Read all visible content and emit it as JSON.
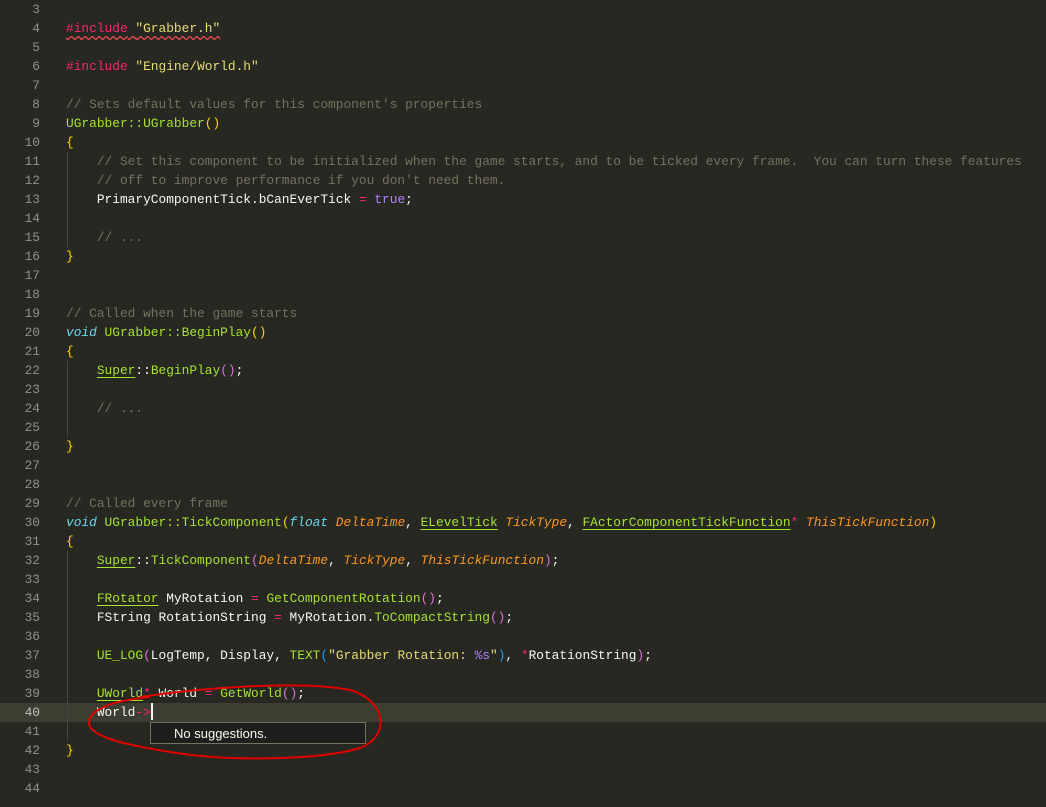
{
  "editor": {
    "current_line": 40,
    "lines": [
      {
        "n": "3",
        "t": []
      },
      {
        "n": "4",
        "t": [
          [
            "kw squig",
            "#include"
          ],
          [
            "squig",
            " "
          ],
          [
            "str squig",
            "\"Grabber.h\""
          ]
        ]
      },
      {
        "n": "5",
        "t": []
      },
      {
        "n": "6",
        "t": [
          [
            "kw",
            "#include"
          ],
          [
            "",
            ""
          ],
          [
            "str",
            " \"Engine/World.h\""
          ]
        ]
      },
      {
        "n": "7",
        "t": []
      },
      {
        "n": "8",
        "t": [
          [
            "cm",
            "// Sets default values for this component's properties"
          ]
        ]
      },
      {
        "n": "9",
        "t": [
          [
            "fn",
            "UGrabber::UGrabber"
          ],
          [
            "b1",
            "()"
          ]
        ]
      },
      {
        "n": "10",
        "t": [
          [
            "b1",
            "{"
          ]
        ]
      },
      {
        "n": "11",
        "t": [
          [
            "cm",
            "    // Set this component to be initialized when the game starts, and to be ticked every frame.  You can turn these features"
          ]
        ]
      },
      {
        "n": "12",
        "t": [
          [
            "cm",
            "    // off to improve performance if you don't need them."
          ]
        ]
      },
      {
        "n": "13",
        "t": [
          [
            "",
            "    PrimaryComponentTick.bCanEverTick "
          ],
          [
            "op",
            "="
          ],
          [
            "num",
            " true"
          ],
          [
            "",
            ";"
          ]
        ]
      },
      {
        "n": "14",
        "t": []
      },
      {
        "n": "15",
        "t": [
          [
            "cm",
            "    // ..."
          ]
        ]
      },
      {
        "n": "16",
        "t": [
          [
            "b1",
            "}"
          ]
        ]
      },
      {
        "n": "17",
        "t": []
      },
      {
        "n": "18",
        "t": []
      },
      {
        "n": "19",
        "t": [
          [
            "cm",
            "// Called when the game starts"
          ]
        ]
      },
      {
        "n": "20",
        "t": [
          [
            "ty",
            "void"
          ],
          [
            "fn",
            " UGrabber::BeginPlay"
          ],
          [
            "b1",
            "()"
          ]
        ]
      },
      {
        "n": "21",
        "t": [
          [
            "b1",
            "{"
          ]
        ]
      },
      {
        "n": "22",
        "t": [
          [
            "",
            "    "
          ],
          [
            "fn ul",
            "Super"
          ],
          [
            "",
            "::"
          ],
          [
            "fn",
            "BeginPlay"
          ],
          [
            "b2",
            "()"
          ],
          [
            "",
            ";"
          ]
        ]
      },
      {
        "n": "23",
        "t": []
      },
      {
        "n": "24",
        "t": [
          [
            "cm",
            "    // ..."
          ]
        ]
      },
      {
        "n": "25",
        "t": []
      },
      {
        "n": "26",
        "t": [
          [
            "b1",
            "}"
          ]
        ]
      },
      {
        "n": "27",
        "t": []
      },
      {
        "n": "28",
        "t": []
      },
      {
        "n": "29",
        "t": [
          [
            "cm",
            "// Called every frame"
          ]
        ]
      },
      {
        "n": "30",
        "t": [
          [
            "ty",
            "void"
          ],
          [
            "fn",
            " UGrabber::TickComponent"
          ],
          [
            "b1",
            "("
          ],
          [
            "ty",
            "float"
          ],
          [
            "pa",
            " DeltaTime"
          ],
          [
            "",
            ", "
          ],
          [
            "fn ul",
            "ELevelTick"
          ],
          [
            "pa",
            " TickType"
          ],
          [
            "",
            ", "
          ],
          [
            "fn ul",
            "FActorComponentTickFunction"
          ],
          [
            "kw",
            "*"
          ],
          [
            "pa",
            " ThisTickFunction"
          ],
          [
            "b1",
            ")"
          ]
        ]
      },
      {
        "n": "31",
        "t": [
          [
            "b1",
            "{"
          ]
        ]
      },
      {
        "n": "32",
        "t": [
          [
            "",
            "    "
          ],
          [
            "fn ul",
            "Super"
          ],
          [
            "",
            "::"
          ],
          [
            "fn",
            "TickComponent"
          ],
          [
            "b2",
            "("
          ],
          [
            "pa",
            "DeltaTime"
          ],
          [
            "",
            ", "
          ],
          [
            "pa",
            "TickType"
          ],
          [
            "",
            ", "
          ],
          [
            "pa",
            "ThisTickFunction"
          ],
          [
            "b2",
            ")"
          ],
          [
            "",
            ";"
          ]
        ]
      },
      {
        "n": "33",
        "t": []
      },
      {
        "n": "34",
        "t": [
          [
            "",
            "    "
          ],
          [
            "fn ul",
            "FRotator"
          ],
          [
            "",
            " MyRotation "
          ],
          [
            "op",
            "="
          ],
          [
            "fn",
            " GetComponentRotation"
          ],
          [
            "b2",
            "()"
          ],
          [
            "",
            ";"
          ]
        ]
      },
      {
        "n": "35",
        "t": [
          [
            "",
            "    FString RotationString "
          ],
          [
            "op",
            "="
          ],
          [
            "",
            " MyRotation."
          ],
          [
            "fn",
            "ToCompactString"
          ],
          [
            "b2",
            "()"
          ],
          [
            "",
            ";"
          ]
        ]
      },
      {
        "n": "36",
        "t": []
      },
      {
        "n": "37",
        "t": [
          [
            "fn",
            "    UE_LOG"
          ],
          [
            "b2",
            "("
          ],
          [
            "",
            "LogTemp, Display, "
          ],
          [
            "fn",
            "TEXT"
          ],
          [
            "b3",
            "("
          ],
          [
            "str",
            "\"Grabber Rotation: "
          ],
          [
            "num",
            "%s"
          ],
          [
            "str",
            "\""
          ],
          [
            "b3",
            ")"
          ],
          [
            "",
            ", "
          ],
          [
            "kw",
            "*"
          ],
          [
            "",
            "RotationString"
          ],
          [
            "b2",
            ")"
          ],
          [
            "",
            ";"
          ]
        ]
      },
      {
        "n": "38",
        "t": []
      },
      {
        "n": "39",
        "t": [
          [
            "",
            "    "
          ],
          [
            "fn ul",
            "UWorld"
          ],
          [
            "kw",
            "*"
          ],
          [
            "",
            " World "
          ],
          [
            "op",
            "="
          ],
          [
            "fn",
            " GetWorld"
          ],
          [
            "b2",
            "()"
          ],
          [
            "",
            ";"
          ]
        ]
      },
      {
        "n": "40",
        "t": [
          [
            "",
            "    World"
          ],
          [
            "op",
            "->"
          ]
        ],
        "caret": true
      },
      {
        "n": "41",
        "t": []
      },
      {
        "n": "42",
        "t": [
          [
            "b1",
            "}"
          ]
        ]
      },
      {
        "n": "43",
        "t": []
      },
      {
        "n": "44",
        "t": []
      }
    ]
  },
  "suggest_widget": {
    "message": "No suggestions."
  },
  "colors": {
    "background": "#272822",
    "current_line": "#3e3d32",
    "annotation": "#e00000"
  }
}
